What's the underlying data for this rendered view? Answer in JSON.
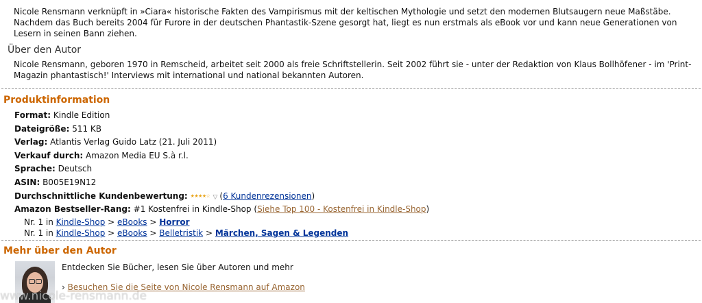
{
  "description": {
    "line1": "Nicole Rensmann verknüpft in »Ciara« historische Fakten des Vampirismus mit der keltischen Mythologie und setzt den modernen Blutsaugern neue Maßstäbe.",
    "line2": "Nachdem das Buch bereits 2004 für Furore in der deutschen Phantastik-Szene gesorgt hat, liegt es nun erstmals als eBook vor und kann neue Generationen von Lesern in seinen Bann ziehen."
  },
  "about_author": {
    "heading": "Über den Autor",
    "text": "Nicole Rensmann, geboren 1970 in Remscheid, arbeitet seit 2000 als freie Schriftstellerin. Seit 2002 führt sie - unter der Redaktion von Klaus Bollhöfener - im 'Print-Magazin phantastisch!' Interviews mit international und national bekannten Autoren."
  },
  "product_info": {
    "heading": "Produktinformation",
    "format_label": "Format:",
    "format_value": "Kindle Edition",
    "size_label": "Dateigröße:",
    "size_value": "511 KB",
    "publisher_label": "Verlag:",
    "publisher_value": "Atlantis Verlag Guido Latz (21. Juli 2011)",
    "seller_label": "Verkauf durch:",
    "seller_value": "Amazon Media EU S.à r.l.",
    "language_label": "Sprache:",
    "language_value": "Deutsch",
    "asin_label": "ASIN:",
    "asin_value": "B005E19N12",
    "rating_label": "Durchschnittliche Kundenbewertung:",
    "rating_stars": "★★★★☆",
    "rating_value": 4.5,
    "reviews_open": "(",
    "reviews_link": "6 Kundenrezensionen",
    "reviews_close": ")",
    "rank_label": "Amazon Bestseller-Rang:",
    "rank_text": "#1 Kostenfrei in Kindle-Shop (",
    "rank_link": "Siehe Top 100 - Kostenfrei in Kindle-Shop",
    "rank_close": ")",
    "sub1": {
      "prefix": "Nr. 1 in",
      "c1": "Kindle-Shop",
      "c2": "eBooks",
      "c3": "Horror",
      "sep": ">"
    },
    "sub2": {
      "prefix": "Nr. 1 in",
      "c1": "Kindle-Shop",
      "c2": "eBooks",
      "c3": "Belletristik",
      "c4": "Märchen, Sagen & Legenden",
      "sep": ">"
    }
  },
  "more_author": {
    "heading": "Mehr über den Autor",
    "tagline": "Entdecken Sie Bücher, lesen Sie über Autoren und mehr",
    "bullet": "›",
    "link": "Besuchen Sie die Seite von Nicole Rensmann auf Amazon",
    "watermark": "www.nicole-rensmann.de"
  }
}
